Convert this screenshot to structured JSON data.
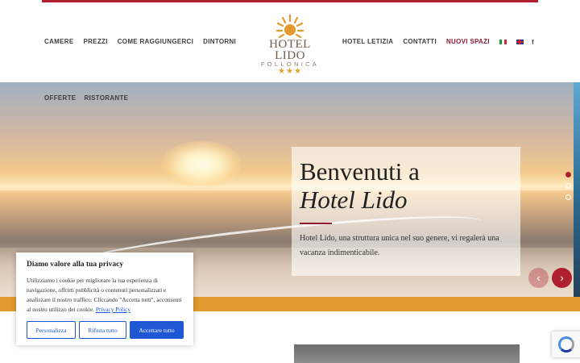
{
  "nav_left": [
    "CAMERE",
    "PREZZI",
    "COME RAGGIUNGERCI",
    "DINTORNI"
  ],
  "nav_right": [
    "HOTEL LETIZIA",
    "CONTATTI",
    "NUOVI SPAZI"
  ],
  "logo": {
    "name": "HOTEL LIDO",
    "town": "FOLLONICA",
    "stars": "★★★"
  },
  "social": {
    "facebook": "f"
  },
  "subnav": [
    "OFFERTE",
    "RISTORANTE"
  ],
  "hero": {
    "title_line1": "Benvenuti a",
    "title_line2": "Hotel Lido",
    "description": "Hotel Lido, una struttura unica nel suo genere, vi regalerà una vacanza indimenticabile.",
    "slide_count": 3,
    "active_slide": 1
  },
  "cookie": {
    "title": "Diamo valore alla tua privacy",
    "text": "Utilizziamo i cookie per migliorare la tua esperienza di navigazione, offrirti pubblicità o contenuti personalizzati e analizzare il nostro traffico. Cliccando \"Accetta tutti\", acconsenti al nostro utilizzo dei cookie.",
    "policy_link": "Privacy Policy",
    "btn_customize": "Personalizza",
    "btn_reject": "Rifiuta tutto",
    "btn_accept": "Accettare tutto"
  },
  "colors": {
    "accent": "#b01f2e",
    "gold": "#e39a2f",
    "cookie_blue": "#1f56d4"
  }
}
